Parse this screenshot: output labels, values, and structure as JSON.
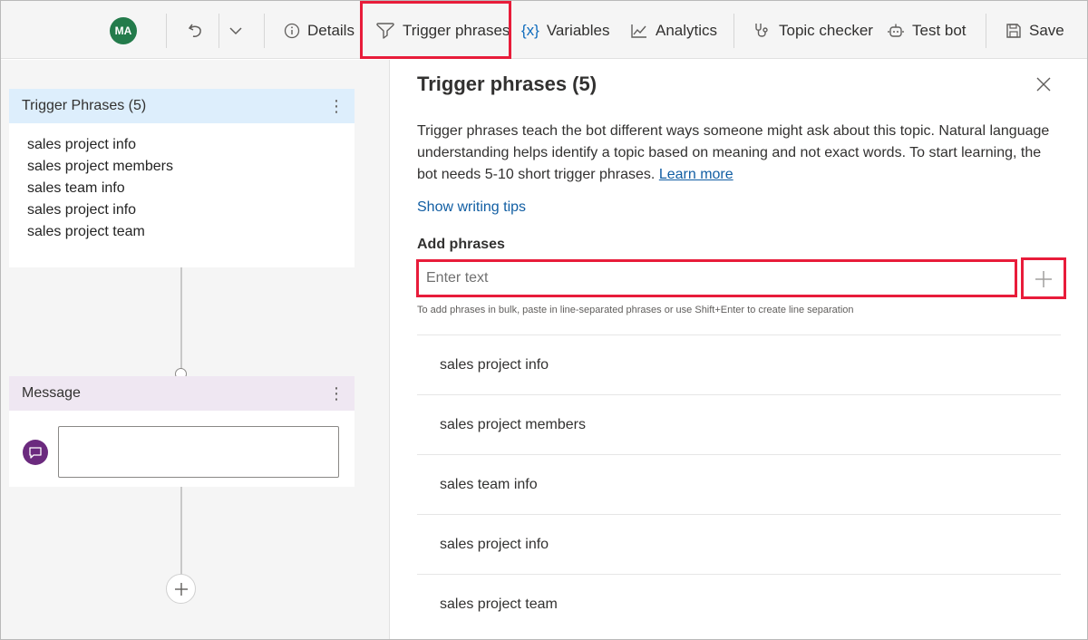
{
  "toolbar": {
    "avatar_initials": "MA",
    "details_label": "Details",
    "trigger_phrases_label": "Trigger phrases",
    "variables_icon": "{x}",
    "variables_label": "Variables",
    "analytics_label": "Analytics",
    "topic_checker_label": "Topic checker",
    "test_bot_label": "Test bot",
    "save_label": "Save"
  },
  "canvas": {
    "trigger_node": {
      "title": "Trigger Phrases (5)",
      "phrases": [
        "sales project info",
        "sales project members",
        "sales team info",
        "sales project info",
        "sales project team"
      ]
    },
    "message_node": {
      "title": "Message"
    }
  },
  "panel": {
    "title": "Trigger phrases (5)",
    "description": "Trigger phrases teach the bot different ways someone might ask about this topic. Natural language understanding helps identify a topic based on meaning and not exact words. To start learning, the bot needs 5-10 short trigger phrases.",
    "learn_more": "Learn more",
    "writing_tips": "Show writing tips",
    "add_label": "Add phrases",
    "input_placeholder": "Enter text",
    "input_value": "",
    "hint": "To add phrases in bulk, paste in line-separated phrases or use Shift+Enter to create line separation",
    "phrases": [
      "sales project info",
      "sales project members",
      "sales team info",
      "sales project info",
      "sales project team"
    ]
  },
  "colors": {
    "highlight": "#e81c3a",
    "avatar": "#237b4b",
    "accent": "#0f6cbd",
    "message_icon": "#6b2a7e",
    "trigger_header": "#ddeefc",
    "message_header": "#efe7f2"
  },
  "icons": {
    "undo": "undo-icon",
    "chevron": "chevron-down-icon",
    "details": "info-icon",
    "trigger": "trigger-icon",
    "variables": "variables-icon",
    "analytics": "analytics-icon",
    "topic_checker": "stethoscope-icon",
    "test_bot": "bot-icon",
    "save": "save-icon",
    "close": "close-icon",
    "add": "plus-icon",
    "message": "chat-bubble-icon"
  }
}
